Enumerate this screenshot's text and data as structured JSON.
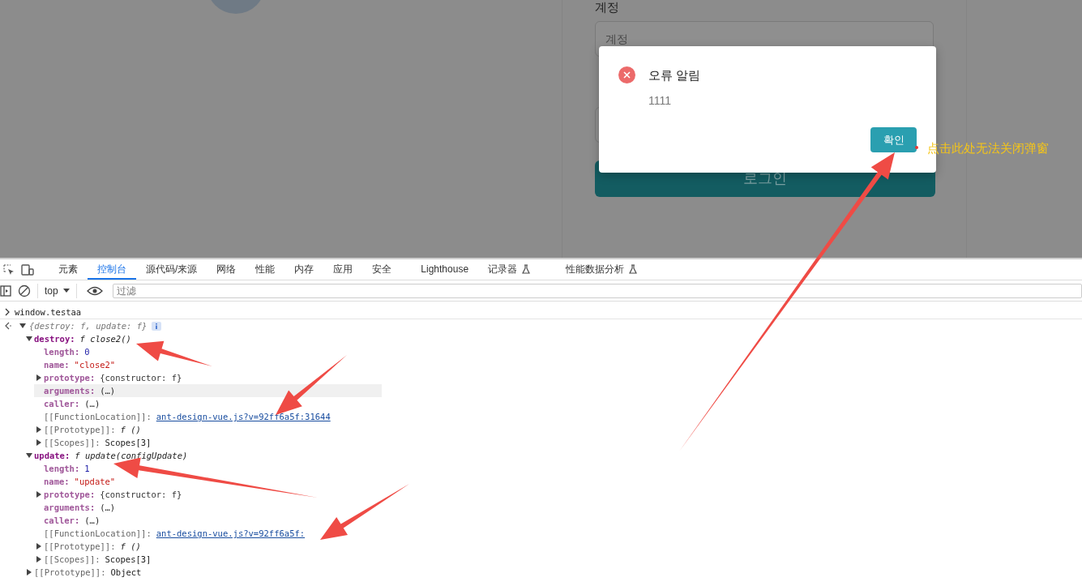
{
  "login_page": {
    "account_label": "계정",
    "account_placeholder": "계정",
    "login_button": "로그인"
  },
  "dialog": {
    "title": "오류 알림",
    "message": "1111",
    "ok_button": "확인"
  },
  "annotation": {
    "text": "点击此处无法关闭弹窗"
  },
  "devtools": {
    "tabs": [
      {
        "label": "元素",
        "selected": false,
        "experimental": false
      },
      {
        "label": "控制台",
        "selected": true,
        "experimental": false
      },
      {
        "label": "源代码/来源",
        "selected": false,
        "experimental": false
      },
      {
        "label": "网络",
        "selected": false,
        "experimental": false
      },
      {
        "label": "性能",
        "selected": false,
        "experimental": false
      },
      {
        "label": "内存",
        "selected": false,
        "experimental": false
      },
      {
        "label": "应用",
        "selected": false,
        "experimental": false
      },
      {
        "label": "安全",
        "selected": false,
        "experimental": false
      },
      {
        "label": "Lighthouse",
        "selected": false,
        "experimental": false
      },
      {
        "label": "记录器",
        "selected": false,
        "experimental": true
      },
      {
        "label": "性能数据分析",
        "selected": false,
        "experimental": true
      }
    ],
    "toolbar": {
      "context": "top",
      "filter_placeholder": "过滤"
    },
    "console": {
      "input": "window.testaa",
      "result": {
        "summary": "{destroy: f, update: f}",
        "expanded": true,
        "children": [
          {
            "key": "destroy:",
            "own": true,
            "internal": false,
            "value": "f close2()",
            "kind": "function",
            "expanded": true,
            "highlighted": false,
            "children": [
              {
                "key": "length:",
                "own": false,
                "internal": false,
                "value": "0",
                "kind": "number",
                "highlighted": false
              },
              {
                "key": "name:",
                "own": false,
                "internal": false,
                "value": "\"close2\"",
                "kind": "string",
                "highlighted": false
              },
              {
                "key": "prototype:",
                "own": false,
                "internal": false,
                "value": "{constructor: f}",
                "kind": "object",
                "expanded": false,
                "highlighted": false
              },
              {
                "key": "arguments:",
                "own": false,
                "internal": false,
                "value": "(…)",
                "kind": "plain",
                "highlighted": true
              },
              {
                "key": "caller:",
                "own": false,
                "internal": false,
                "value": "(…)",
                "kind": "plain",
                "highlighted": false
              },
              {
                "key": "[[FunctionLocation]]:",
                "own": false,
                "internal": true,
                "value": "ant-design-vue.js?v=92ff6a5f:31644",
                "kind": "link",
                "highlighted": false
              },
              {
                "key": "[[Prototype]]:",
                "own": false,
                "internal": true,
                "value": "f ()",
                "kind": "function",
                "expanded": false,
                "highlighted": false
              },
              {
                "key": "[[Scopes]]:",
                "own": false,
                "internal": true,
                "value": "Scopes[3]",
                "kind": "plain",
                "expanded": false,
                "highlighted": false
              }
            ]
          },
          {
            "key": "update:",
            "own": true,
            "internal": false,
            "value": "f update(configUpdate)",
            "kind": "function",
            "expanded": true,
            "highlighted": false,
            "children": [
              {
                "key": "length:",
                "own": false,
                "internal": false,
                "value": "1",
                "kind": "number",
                "highlighted": false
              },
              {
                "key": "name:",
                "own": false,
                "internal": false,
                "value": "\"update\"",
                "kind": "string",
                "highlighted": false
              },
              {
                "key": "prototype:",
                "own": false,
                "internal": false,
                "value": "{constructor: f}",
                "kind": "object",
                "expanded": false,
                "highlighted": false
              },
              {
                "key": "arguments:",
                "own": false,
                "internal": false,
                "value": "(…)",
                "kind": "plain",
                "highlighted": false
              },
              {
                "key": "caller:",
                "own": false,
                "internal": false,
                "value": "(…)",
                "kind": "plain",
                "highlighted": false
              },
              {
                "key": "[[FunctionLocation]]:",
                "own": false,
                "internal": true,
                "value": "ant-design-vue.js?v=92ff6a5f:",
                "kind": "link",
                "highlighted": false
              },
              {
                "key": "[[Prototype]]:",
                "own": false,
                "internal": true,
                "value": "f ()",
                "kind": "function",
                "expanded": false,
                "highlighted": false
              },
              {
                "key": "[[Scopes]]:",
                "own": false,
                "internal": true,
                "value": "Scopes[3]",
                "kind": "plain",
                "expanded": false,
                "highlighted": false
              }
            ]
          },
          {
            "key": "[[Prototype]]:",
            "own": false,
            "internal": true,
            "value": "Object",
            "kind": "plain",
            "expanded": false,
            "highlighted": false
          }
        ]
      }
    }
  }
}
